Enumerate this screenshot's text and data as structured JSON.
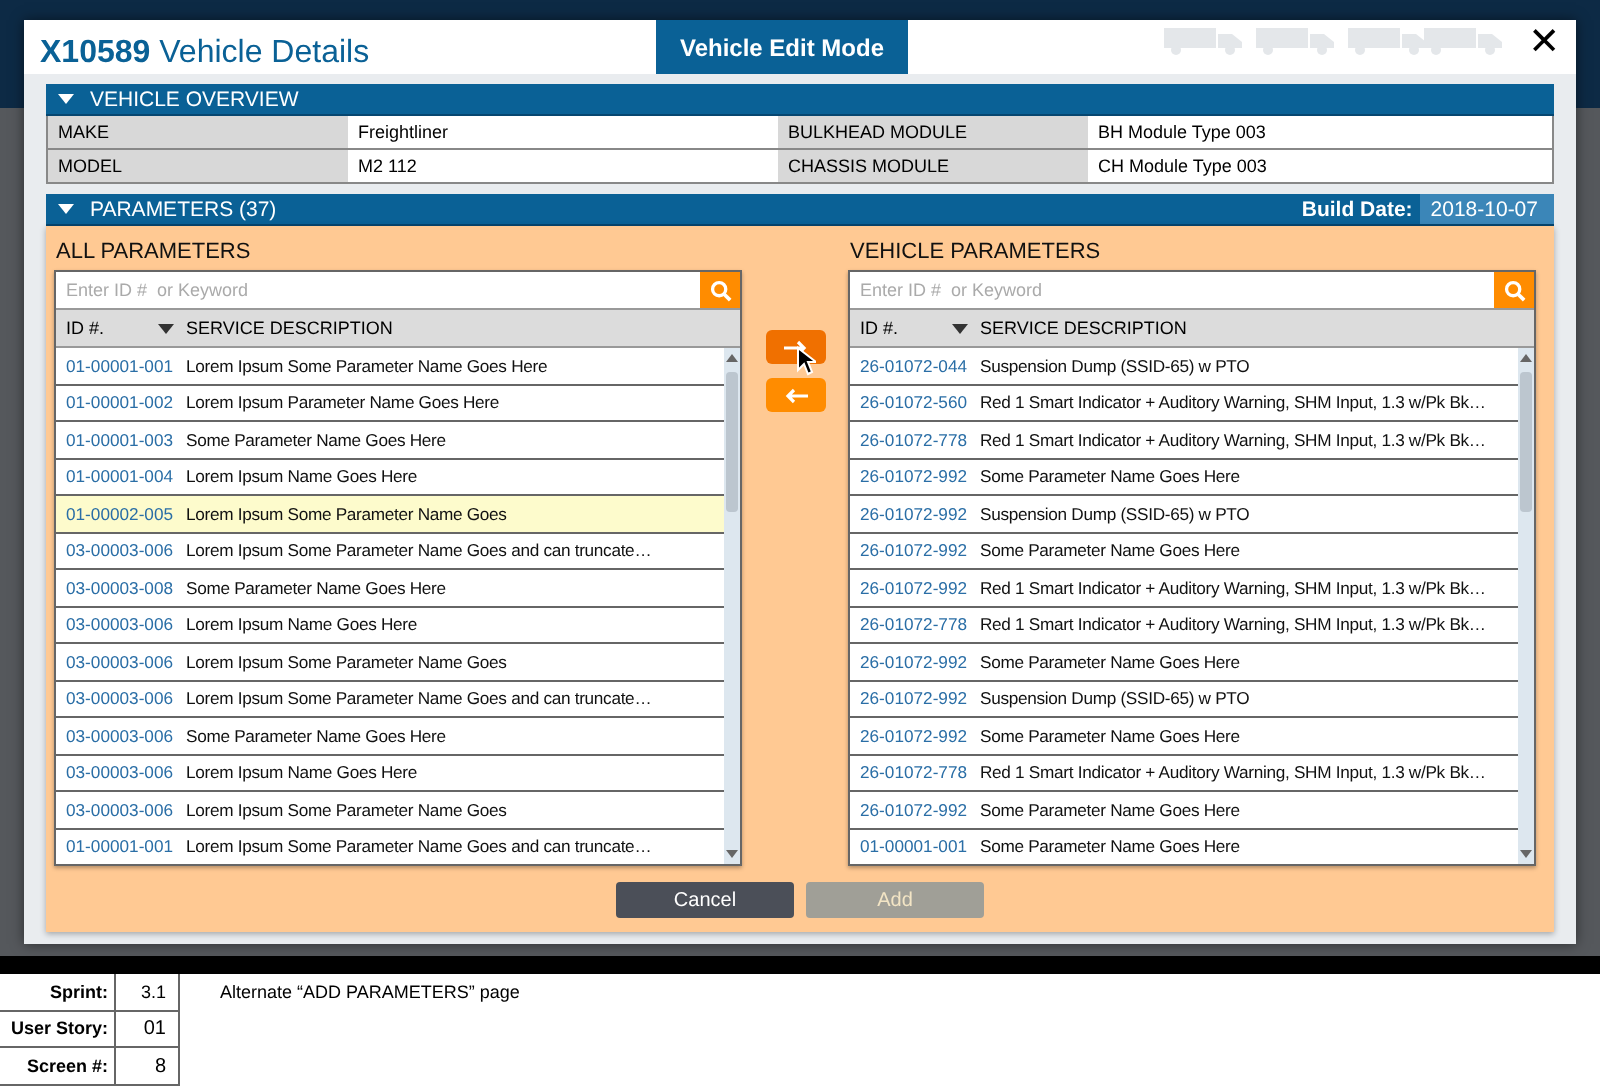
{
  "window": {
    "title_id": "X10589",
    "title": "Vehicle Details",
    "mode_tab": "Vehicle Edit Mode",
    "close": "✕"
  },
  "overview": {
    "title": "VEHICLE OVERVIEW",
    "fields": [
      {
        "label": "MAKE",
        "value": "Freightliner"
      },
      {
        "label": "BULKHEAD MODULE",
        "value": "BH Module Type 003"
      },
      {
        "label": "MODEL",
        "value": "M2 112"
      },
      {
        "label": "CHASSIS MODULE",
        "value": "CH Module Type 003"
      }
    ]
  },
  "parameters": {
    "title": "PARAMETERS (37)",
    "build_date_label": "Build Date:",
    "build_date": "2018-10-07",
    "lists": [
      {
        "title": "ALL PARAMETERS",
        "placeholder": "Enter ID #  or Keyword",
        "columns": [
          "ID #.",
          "SERVICE DESCRIPTION"
        ],
        "rows": [
          {
            "id": "01-00001-001",
            "desc": "Lorem Ipsum Some Parameter Name Goes Here",
            "selected": false
          },
          {
            "id": "01-00001-002",
            "desc": "Lorem Ipsum Parameter Name Goes Here",
            "selected": false
          },
          {
            "id": "01-00001-003",
            "desc": "Some Parameter Name Goes Here",
            "selected": false
          },
          {
            "id": "01-00001-004",
            "desc": "Lorem Ipsum Name Goes Here",
            "selected": false
          },
          {
            "id": "01-00002-005",
            "desc": "Lorem Ipsum Some Parameter Name Goes",
            "selected": true
          },
          {
            "id": "03-00003-006",
            "desc": "Lorem Ipsum Some Parameter Name Goes and can truncate…",
            "selected": false
          },
          {
            "id": "03-00003-008",
            "desc": "Some Parameter Name Goes Here",
            "selected": false
          },
          {
            "id": "03-00003-006",
            "desc": "Lorem Ipsum Name Goes Here",
            "selected": false
          },
          {
            "id": "03-00003-006",
            "desc": "Lorem Ipsum Some Parameter Name Goes",
            "selected": false
          },
          {
            "id": "03-00003-006",
            "desc": "Lorem Ipsum Some Parameter Name Goes and can truncate…",
            "selected": false
          },
          {
            "id": "03-00003-006",
            "desc": "Some Parameter Name Goes Here",
            "selected": false
          },
          {
            "id": "03-00003-006",
            "desc": "Lorem Ipsum Name Goes Here",
            "selected": false
          },
          {
            "id": "03-00003-006",
            "desc": "Lorem Ipsum Some Parameter Name Goes",
            "selected": false
          },
          {
            "id": "01-00001-001",
            "desc": "Lorem Ipsum Some Parameter Name Goes and can truncate…",
            "selected": false
          }
        ]
      },
      {
        "title": "VEHICLE PARAMETERS",
        "placeholder": "Enter ID #  or Keyword",
        "columns": [
          "ID #.",
          "SERVICE DESCRIPTION"
        ],
        "rows": [
          {
            "id": "26-01072-044",
            "desc": "Suspension Dump (SSID-65) w PTO",
            "selected": false
          },
          {
            "id": "26-01072-560",
            "desc": "Red 1 Smart Indicator + Auditory Warning, SHM Input, 1.3 w/Pk Bk…",
            "selected": false
          },
          {
            "id": "26-01072-778",
            "desc": "Red 1 Smart Indicator + Auditory Warning, SHM Input, 1.3 w/Pk Bk…",
            "selected": false
          },
          {
            "id": "26-01072-992",
            "desc": "Some Parameter Name Goes Here",
            "selected": false
          },
          {
            "id": "26-01072-992",
            "desc": "Suspension Dump (SSID-65) w PTO",
            "selected": false
          },
          {
            "id": "26-01072-992",
            "desc": "Some Parameter Name Goes Here",
            "selected": false
          },
          {
            "id": "26-01072-992",
            "desc": "Red 1 Smart Indicator + Auditory Warning, SHM Input, 1.3 w/Pk Bk…",
            "selected": false
          },
          {
            "id": "26-01072-778",
            "desc": "Red 1 Smart Indicator + Auditory Warning, SHM Input, 1.3 w/Pk Bk…",
            "selected": false
          },
          {
            "id": "26-01072-992",
            "desc": "Some Parameter Name Goes Here",
            "selected": false
          },
          {
            "id": "26-01072-992",
            "desc": "Suspension Dump (SSID-65) w PTO",
            "selected": false
          },
          {
            "id": "26-01072-992",
            "desc": "Some Parameter Name Goes Here",
            "selected": false
          },
          {
            "id": "26-01072-778",
            "desc": "Red 1 Smart Indicator + Auditory Warning, SHM Input, 1.3 w/Pk Bk…",
            "selected": false
          },
          {
            "id": "26-01072-992",
            "desc": "Some Parameter Name Goes Here",
            "selected": false
          },
          {
            "id": "01-00001-001",
            "desc": "Some Parameter Name Goes Here",
            "selected": false
          }
        ]
      }
    ],
    "buttons": [
      {
        "label": "Cancel",
        "disabled": false
      },
      {
        "label": "Add",
        "disabled": true
      }
    ]
  },
  "footer": {
    "fields": [
      {
        "label": "Sprint:",
        "value": "3.1"
      },
      {
        "label": "User Story:",
        "value": "01"
      },
      {
        "label": "Screen #:",
        "value": "8"
      }
    ],
    "note": "Alternate “ADD PARAMETERS” page"
  }
}
